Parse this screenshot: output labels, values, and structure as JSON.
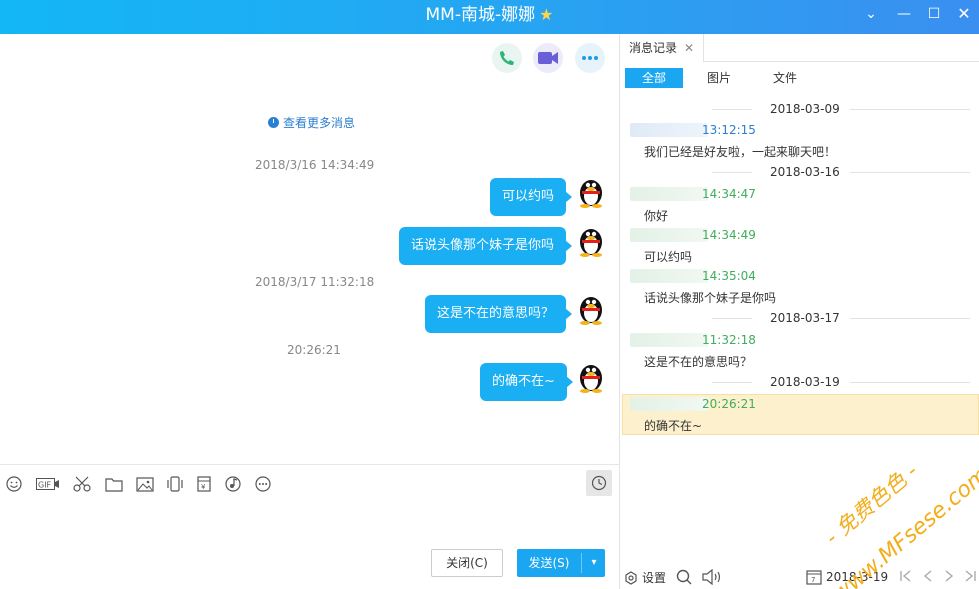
{
  "window": {
    "title": "MM-南城-娜娜",
    "title_star": "★",
    "controls": {
      "chevron": "⌄",
      "minimize": "—",
      "maximize": "☐",
      "close": "✕"
    }
  },
  "chat": {
    "more_messages": "查看更多消息",
    "messages": [
      {
        "type": "timestamp",
        "text": "2018/3/16 14:34:49"
      },
      {
        "type": "bubble",
        "text": "可以约吗"
      },
      {
        "type": "bubble",
        "text": "话说头像那个妹子是你吗"
      },
      {
        "type": "timestamp",
        "text": "2018/3/17 11:32:18"
      },
      {
        "type": "bubble",
        "text": "这是不在的意思吗？"
      },
      {
        "type": "timestamp",
        "text": "20:26:21"
      },
      {
        "type": "bubble",
        "text": "的确不在~"
      }
    ],
    "buttons": {
      "close": "关闭(C)",
      "send": "发送(S)"
    }
  },
  "history": {
    "tab_label": "消息记录",
    "filters": [
      "全部",
      "图片",
      "文件"
    ],
    "dates": [
      "2018-03-09",
      "2018-03-16",
      "2018-03-17",
      "2018-03-19"
    ],
    "records": [
      {
        "time": "13:12:15",
        "text": "我们已经是好友啦，一起来聊天吧！"
      },
      {
        "time": "14:34:47",
        "text": "你好"
      },
      {
        "time": "14:34:49",
        "text": "可以约吗"
      },
      {
        "time": "14:35:04",
        "text": "话说头像那个妹子是你吗"
      },
      {
        "time": "11:32:18",
        "text": "这是不在的意思吗？"
      },
      {
        "time": "20:26:21",
        "text": "的确不在~"
      }
    ],
    "footer": {
      "settings": "设置",
      "date": "2018-3-19"
    }
  },
  "watermark": {
    "line1": "- 免费色色 -",
    "line2": "www.MFsese.com"
  },
  "colors": {
    "accent": "#1aa6f0",
    "bubble": "#1aaef2",
    "highlight": "#fdf0cc",
    "green_time": "#3fae5b",
    "blue_time": "#2b7fd0"
  }
}
